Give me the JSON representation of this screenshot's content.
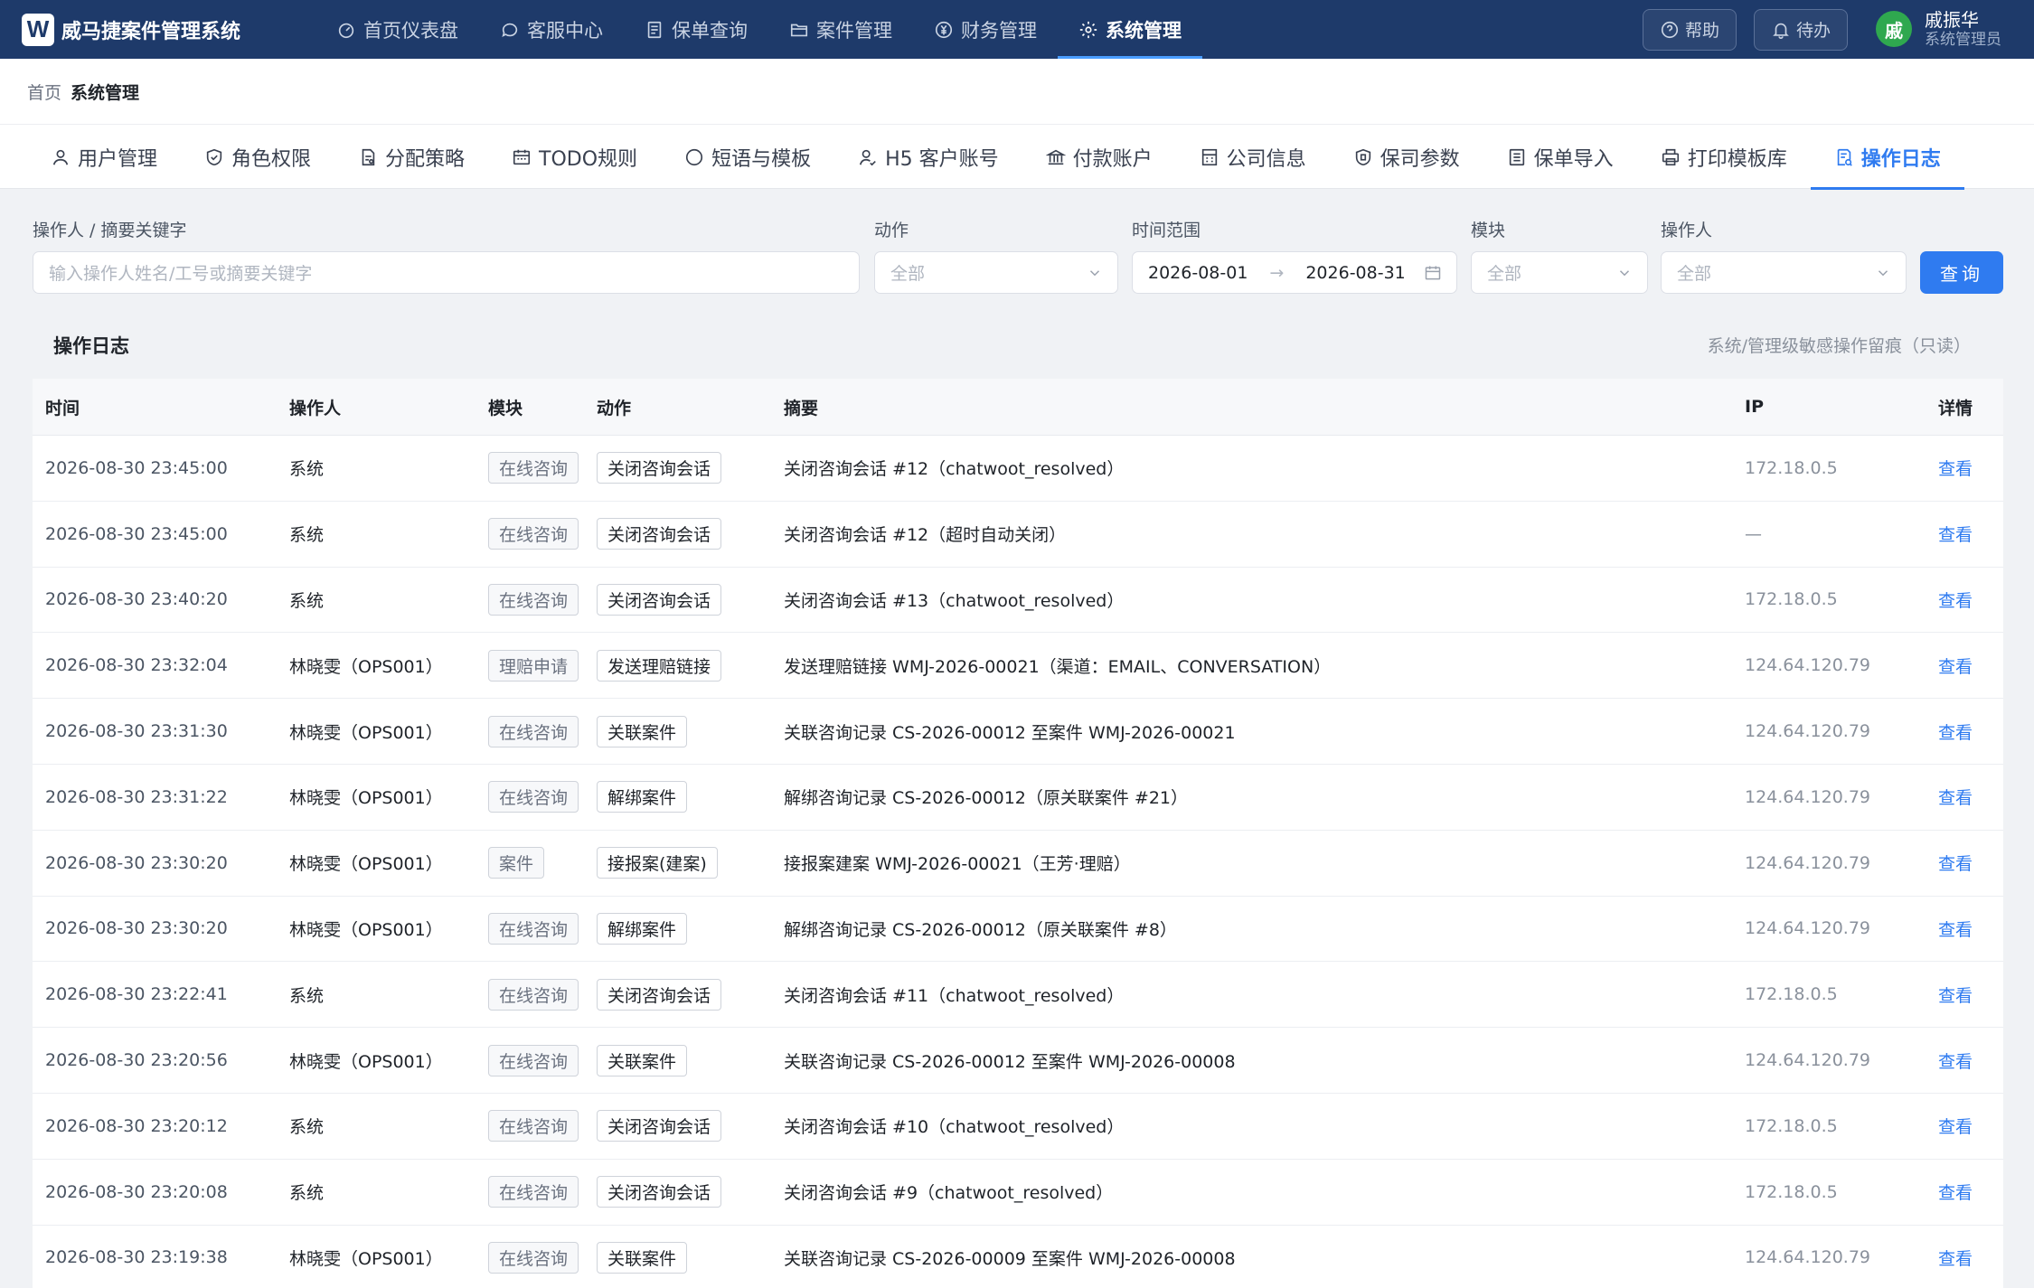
{
  "app": {
    "logo_letter": "W",
    "title": "威马捷案件管理系统"
  },
  "nav": [
    {
      "label": "首页仪表盘",
      "icon": "dashboard-icon",
      "active": false
    },
    {
      "label": "客服中心",
      "icon": "chat-icon",
      "active": false
    },
    {
      "label": "保单查询",
      "icon": "document-icon",
      "active": false
    },
    {
      "label": "案件管理",
      "icon": "folder-icon",
      "active": false
    },
    {
      "label": "财务管理",
      "icon": "yen-icon",
      "active": false
    },
    {
      "label": "系统管理",
      "icon": "gear-icon",
      "active": true
    }
  ],
  "top_actions": {
    "help": "帮助",
    "todo": "待办"
  },
  "user": {
    "avatar": "戚",
    "name": "戚振华",
    "role": "系统管理员"
  },
  "breadcrumb": {
    "home": "首页",
    "current": "系统管理"
  },
  "subtabs": [
    {
      "label": "用户管理",
      "icon": "user-icon",
      "active": false
    },
    {
      "label": "角色权限",
      "icon": "shield-check-icon",
      "active": false
    },
    {
      "label": "分配策略",
      "icon": "strategy-icon",
      "active": false
    },
    {
      "label": "TODO规则",
      "icon": "calendar-icon",
      "active": false
    },
    {
      "label": "短语与模板",
      "icon": "message-icon",
      "active": false
    },
    {
      "label": "H5 客户账号",
      "icon": "account-icon",
      "active": false
    },
    {
      "label": "付款账户",
      "icon": "bank-icon",
      "active": false
    },
    {
      "label": "公司信息",
      "icon": "building-icon",
      "active": false
    },
    {
      "label": "保司参数",
      "icon": "badge-icon",
      "active": false
    },
    {
      "label": "保单导入",
      "icon": "list-icon",
      "active": false
    },
    {
      "label": "打印模板库",
      "icon": "printer-icon",
      "active": false
    },
    {
      "label": "操作日志",
      "icon": "log-icon",
      "active": true
    }
  ],
  "filters": {
    "keyword_label": "操作人 / 摘要关键字",
    "keyword_placeholder": "输入操作人姓名/工号或摘要关键字",
    "action_label": "动作",
    "action_value": "全部",
    "time_label": "时间范围",
    "date_start": "2026-08-01",
    "date_sep": "→",
    "date_end": "2026-08-31",
    "module_label": "模块",
    "module_value": "全部",
    "operator_label": "操作人",
    "operator_value": "全部",
    "query_button": "查询"
  },
  "section": {
    "title": "操作日志",
    "note": "系统/管理级敏感操作留痕（只读）"
  },
  "table": {
    "columns": {
      "time": "时间",
      "operator": "操作人",
      "module": "模块",
      "action": "动作",
      "summary": "摘要",
      "ip": "IP",
      "detail": "详情"
    },
    "detail_link": "查看",
    "rows": [
      {
        "time": "2026-08-30 23:45:00",
        "operator": "系统",
        "module": "在线咨询",
        "action": "关闭咨询会话",
        "summary": "关闭咨询会话 #12（chatwoot_resolved）",
        "ip": "172.18.0.5"
      },
      {
        "time": "2026-08-30 23:45:00",
        "operator": "系统",
        "module": "在线咨询",
        "action": "关闭咨询会话",
        "summary": "关闭咨询会话 #12（超时自动关闭）",
        "ip": "—"
      },
      {
        "time": "2026-08-30 23:40:20",
        "operator": "系统",
        "module": "在线咨询",
        "action": "关闭咨询会话",
        "summary": "关闭咨询会话 #13（chatwoot_resolved）",
        "ip": "172.18.0.5"
      },
      {
        "time": "2026-08-30 23:32:04",
        "operator": "林晓雯（OPS001）",
        "module": "理赔申请",
        "action": "发送理赔链接",
        "summary": "发送理赔链接 WMJ-2026-00021（渠道：EMAIL、CONVERSATION）",
        "ip": "124.64.120.79"
      },
      {
        "time": "2026-08-30 23:31:30",
        "operator": "林晓雯（OPS001）",
        "module": "在线咨询",
        "action": "关联案件",
        "summary": "关联咨询记录 CS-2026-00012 至案件 WMJ-2026-00021",
        "ip": "124.64.120.79"
      },
      {
        "time": "2026-08-30 23:31:22",
        "operator": "林晓雯（OPS001）",
        "module": "在线咨询",
        "action": "解绑案件",
        "summary": "解绑咨询记录 CS-2026-00012（原关联案件 #21）",
        "ip": "124.64.120.79"
      },
      {
        "time": "2026-08-30 23:30:20",
        "operator": "林晓雯（OPS001）",
        "module": "案件",
        "action": "接报案(建案)",
        "summary": "接报案建案 WMJ-2026-00021（王芳·理赔）",
        "ip": "124.64.120.79"
      },
      {
        "time": "2026-08-30 23:30:20",
        "operator": "林晓雯（OPS001）",
        "module": "在线咨询",
        "action": "解绑案件",
        "summary": "解绑咨询记录 CS-2026-00012（原关联案件 #8）",
        "ip": "124.64.120.79"
      },
      {
        "time": "2026-08-30 23:22:41",
        "operator": "系统",
        "module": "在线咨询",
        "action": "关闭咨询会话",
        "summary": "关闭咨询会话 #11（chatwoot_resolved）",
        "ip": "172.18.0.5"
      },
      {
        "time": "2026-08-30 23:20:56",
        "operator": "林晓雯（OPS001）",
        "module": "在线咨询",
        "action": "关联案件",
        "summary": "关联咨询记录 CS-2026-00012 至案件 WMJ-2026-00008",
        "ip": "124.64.120.79"
      },
      {
        "time": "2026-08-30 23:20:12",
        "operator": "系统",
        "module": "在线咨询",
        "action": "关闭咨询会话",
        "summary": "关闭咨询会话 #10（chatwoot_resolved）",
        "ip": "172.18.0.5"
      },
      {
        "time": "2026-08-30 23:20:08",
        "operator": "系统",
        "module": "在线咨询",
        "action": "关闭咨询会话",
        "summary": "关闭咨询会话 #9（chatwoot_resolved）",
        "ip": "172.18.0.5"
      },
      {
        "time": "2026-08-30 23:19:38",
        "operator": "林晓雯（OPS001）",
        "module": "在线咨询",
        "action": "关联案件",
        "summary": "关联咨询记录 CS-2026-00009 至案件 WMJ-2026-00008",
        "ip": "124.64.120.79"
      }
    ]
  },
  "colors": {
    "nav_bg": "#1e3a6a",
    "accent": "#2f7bf0",
    "avatar_bg": "#2fa84f"
  }
}
